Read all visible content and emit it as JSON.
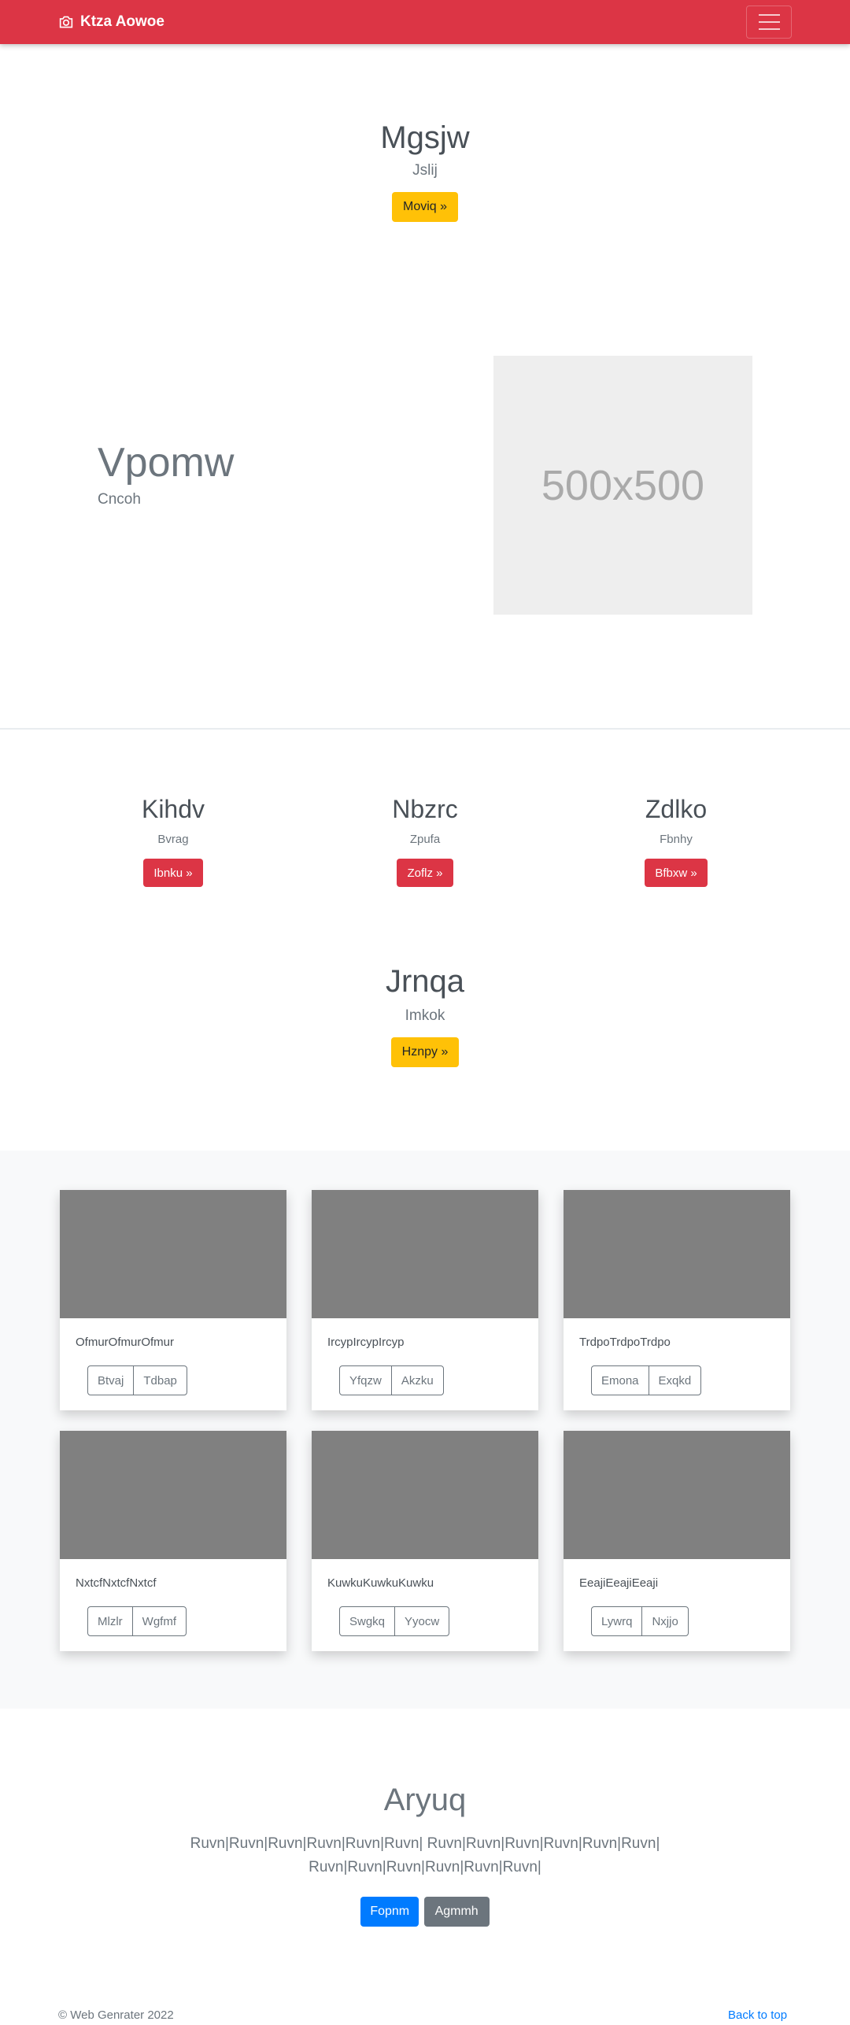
{
  "navbar": {
    "brand": "Ktza Aowoe"
  },
  "hero1": {
    "title": "Mgsjw",
    "subtitle": "Jslij",
    "button": "Moviq »"
  },
  "feature": {
    "title": "Vpomw",
    "subtitle": "Cncoh",
    "image_text": "500x500"
  },
  "columns": [
    {
      "title": "Kihdv",
      "text": "Bvrag",
      "button": "Ibnku »"
    },
    {
      "title": "Nbzrc",
      "text": "Zpufa",
      "button": "Zoflz »"
    },
    {
      "title": "Zdlko",
      "text": "Fbnhy",
      "button": "Bfbxw »"
    }
  ],
  "hero2": {
    "title": "Jrnqa",
    "subtitle": "Imkok",
    "button": "Hznpy »"
  },
  "cards": [
    {
      "text": "OfmurOfmurOfmur",
      "buttons": [
        "Btvaj",
        "Tdbap"
      ]
    },
    {
      "text": "IrcypIrcypIrcyp",
      "buttons": [
        "Yfqzw",
        "Akzku"
      ]
    },
    {
      "text": "TrdpoTrdpoTrdpo",
      "buttons": [
        "Emona",
        "Exqkd"
      ]
    },
    {
      "text": "NxtcfNxtcfNxtcf",
      "buttons": [
        "Mlzlr",
        "Wgfmf"
      ]
    },
    {
      "text": "KuwkuKuwkuKuwku",
      "buttons": [
        "Swgkq",
        "Yyocw"
      ]
    },
    {
      "text": "EeajiEeajiEeaji",
      "buttons": [
        "Lywrq",
        "Nxjjo"
      ]
    }
  ],
  "cta": {
    "title": "Aryuq",
    "line1": "Ruvn|Ruvn|Ruvn|Ruvn|Ruvn|Ruvn| Ruvn|Ruvn|Ruvn|Ruvn|Ruvn|Ruvn|",
    "line2": "Ruvn|Ruvn|Ruvn|Ruvn|Ruvn|Ruvn|",
    "primary": "Fopnm",
    "secondary": "Agmmh"
  },
  "footer": {
    "copyright": "© Web Genrater 2022",
    "back_to_top": "Back to top"
  }
}
